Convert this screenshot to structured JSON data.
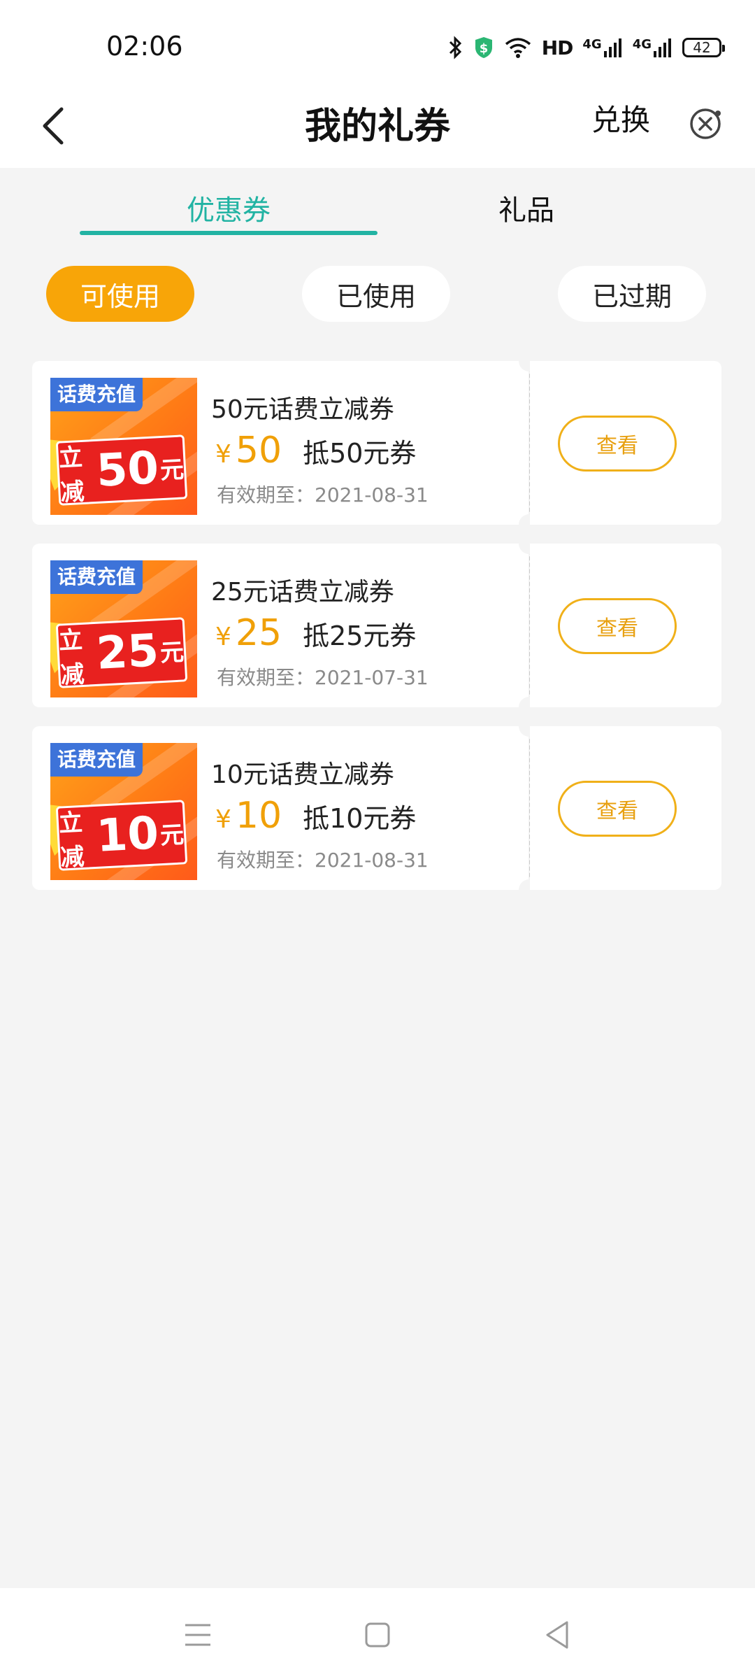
{
  "status_bar": {
    "time": "02:06",
    "network_text": "HD",
    "signal1": "4G",
    "signal2": "4G",
    "battery": "42",
    "icons": [
      "bluetooth-icon",
      "security-shield-icon",
      "wifi-icon"
    ]
  },
  "header": {
    "title": "我的礼券",
    "exchange_label": "兑换",
    "icons": {
      "back": "chevron-left-icon",
      "close": "close-circle-icon"
    }
  },
  "tabs": [
    {
      "label": "优惠券",
      "active": true
    },
    {
      "label": "礼品",
      "active": false
    }
  ],
  "filters": [
    {
      "label": "可使用",
      "active": true
    },
    {
      "label": "已使用",
      "active": false
    },
    {
      "label": "已过期",
      "active": false
    }
  ],
  "coupons": [
    {
      "thumb_tag": "话费充值",
      "thumb_prefix": "立减",
      "thumb_amount": "50",
      "thumb_unit": "元",
      "title": "50元话费立减券",
      "currency": "¥",
      "amount": "50",
      "desc": "抵50元券",
      "expiry": "有效期至：2021-08-31",
      "button": "查看"
    },
    {
      "thumb_tag": "话费充值",
      "thumb_prefix": "立减",
      "thumb_amount": "25",
      "thumb_unit": "元",
      "title": "25元话费立减券",
      "currency": "¥",
      "amount": "25",
      "desc": "抵25元券",
      "expiry": "有效期至：2021-07-31",
      "button": "查看"
    },
    {
      "thumb_tag": "话费充值",
      "thumb_prefix": "立减",
      "thumb_amount": "10",
      "thumb_unit": "元",
      "title": "10元话费立减券",
      "currency": "¥",
      "amount": "10",
      "desc": "抵10元券",
      "expiry": "有效期至：2021-08-31",
      "button": "查看"
    }
  ],
  "colors": {
    "accent_teal": "#22b3a3",
    "accent_orange": "#f8a508",
    "price_orange": "#f0a008",
    "background": "#f4f4f4"
  },
  "bottom_nav": {
    "icons": [
      "menu-icon",
      "home-square-icon",
      "back-triangle-icon"
    ]
  }
}
